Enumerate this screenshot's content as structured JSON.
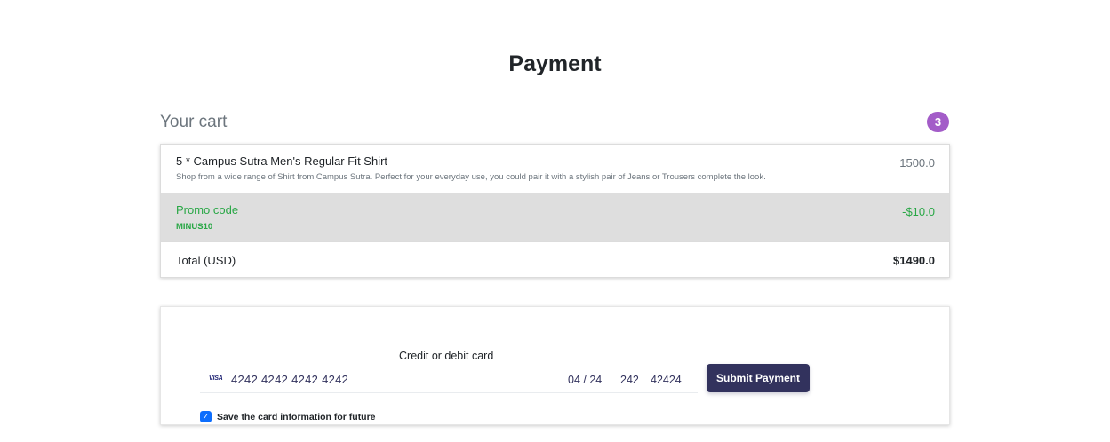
{
  "page": {
    "title": "Payment"
  },
  "cart": {
    "heading": "Your cart",
    "badge_count": "3",
    "item": {
      "name": "5 * Campus Sutra Men's Regular Fit Shirt",
      "description": "Shop from a wide range of Shirt from Campus Sutra. Perfect for your everyday use, you could pair it with a stylish pair of Jeans or Trousers complete the look.",
      "price": "1500.0"
    },
    "promo": {
      "label": "Promo code",
      "code": "MINUS10",
      "amount": "-$10.0"
    },
    "total": {
      "label": "Total (USD)",
      "value": "$1490.0"
    }
  },
  "payment": {
    "card_caption": "Credit or debit card",
    "card_brand": "VISA",
    "card_number": "4242 4242 4242 4242",
    "expiry": "04 / 24",
    "cvc": "242",
    "zip": "42424",
    "submit_label": "Submit Payment",
    "save_card_label": "Save the card information for future",
    "save_card_checked": true
  },
  "colors": {
    "badge": "#a35cc8",
    "promo_text": "#28a745",
    "submit_bg": "#32325d",
    "checkbox": "#0d6efd"
  }
}
